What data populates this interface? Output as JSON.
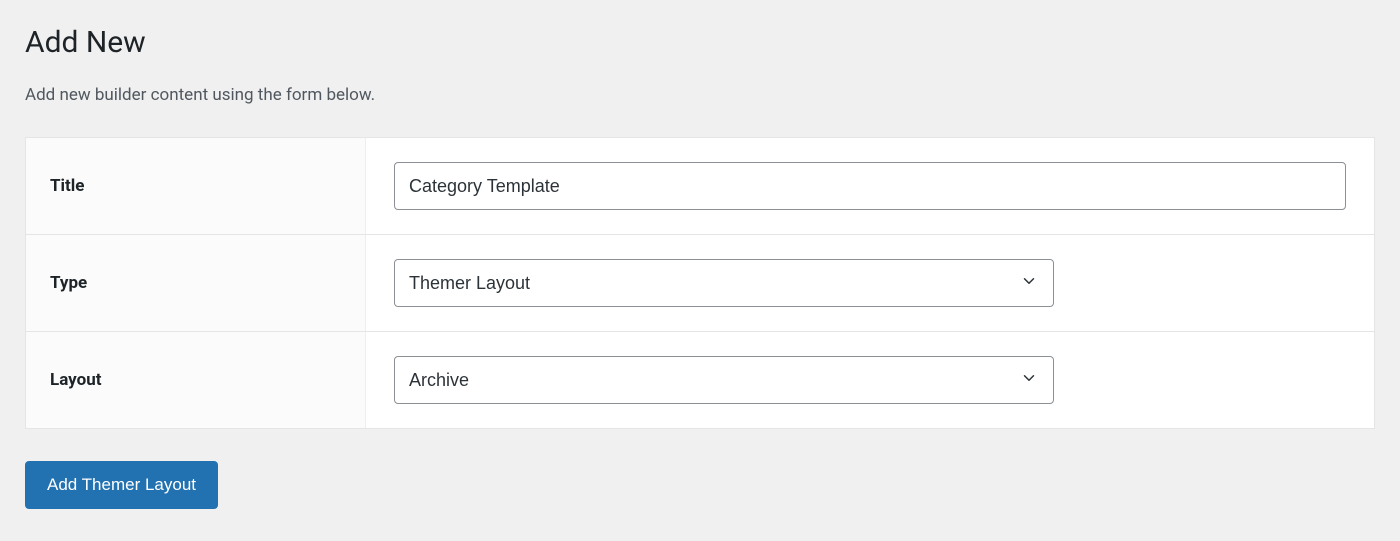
{
  "header": {
    "title": "Add New",
    "description": "Add new builder content using the form below."
  },
  "form": {
    "title": {
      "label": "Title",
      "value": "Category Template"
    },
    "type": {
      "label": "Type",
      "value": "Themer Layout"
    },
    "layout": {
      "label": "Layout",
      "value": "Archive"
    }
  },
  "actions": {
    "submit_label": "Add Themer Layout"
  }
}
